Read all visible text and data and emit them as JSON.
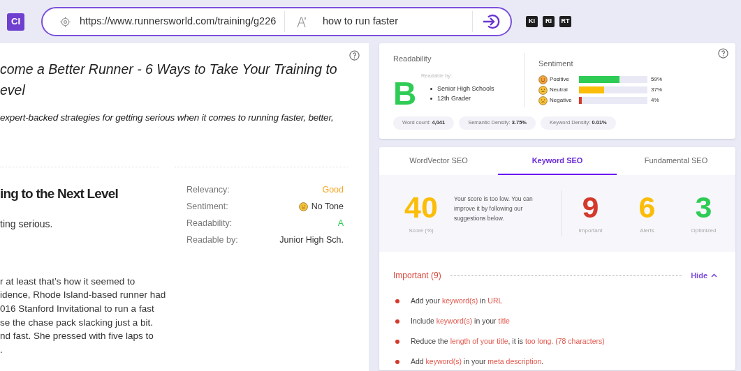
{
  "header": {
    "logo": "CI",
    "url_field": {
      "value": "https://www.runnersworld.com/training/g226"
    },
    "keyword_field": {
      "value": "how to run faster"
    },
    "tools": [
      "KI",
      "RI",
      "RT"
    ]
  },
  "article": {
    "title_lines": [
      "come a Better Runner - 6 Ways to Take Your Training to",
      "evel"
    ],
    "subtitle": "expert-backed strategies for getting serious when it comes to running faster, better,",
    "heading": "ing to the Next Level",
    "heading_sub": "ting serious.",
    "paragraph_lines": [
      "r at least that’s how it seemed to",
      "idence, Rhode Island-based runner had",
      "016 Stanford Invitational to run a fast",
      "se the chase pack slacking just a bit.",
      "nd fast. She pressed with five laps to",
      "."
    ],
    "meta": [
      {
        "label": "Relevancy:",
        "value": "Good",
        "kind": "rating",
        "color": "#f5a623"
      },
      {
        "label": "Sentiment:",
        "value": "No Tone",
        "kind": "emoji",
        "color": "#333333"
      },
      {
        "label": "Readability:",
        "value": "A",
        "kind": "rating",
        "color": "#2ecc55"
      },
      {
        "label": "Readable by:",
        "value": "Junior High Sch.",
        "kind": "text",
        "color": "#333333"
      }
    ]
  },
  "summary": {
    "readability": {
      "title": "Readability",
      "grade": "B",
      "readable_by_label": "Readable by:",
      "readable_by": [
        "Senior High Schools",
        "12th Grader"
      ]
    },
    "sentiment": {
      "title": "Sentiment",
      "rows": [
        {
          "label": "Positive",
          "level": 0.59,
          "reading": "59%",
          "color": "#2ecc55",
          "kind": "positive"
        },
        {
          "label": "Neutral",
          "level": 0.37,
          "reading": "37%",
          "color": "#fbbd08",
          "kind": "neutral"
        },
        {
          "label": "Negative",
          "level": 0.04,
          "reading": "4%",
          "color": "#d33a2c",
          "kind": "negative"
        }
      ]
    },
    "stats": [
      {
        "label": "Word count:",
        "value": "4,041"
      },
      {
        "label": "Semantic Density:",
        "value": "3.75%"
      },
      {
        "label": "Keyword Density:",
        "value": "0.01%"
      }
    ]
  },
  "seo": {
    "tabs": [
      {
        "label": "WordVector SEO",
        "selected": false
      },
      {
        "label": "Keyword SEO",
        "selected": true
      },
      {
        "label": "Fundamental SEO",
        "selected": false
      }
    ],
    "score": {
      "value": "40",
      "label": "Score (%)",
      "message": "Your score is too low. You can improve it by following our suggestions below."
    },
    "counts": [
      {
        "value": "9",
        "label": "Important",
        "color": "#d33a2c"
      },
      {
        "value": "6",
        "label": "Alerts",
        "color": "#fbbd08"
      },
      {
        "value": "3",
        "label": "Optimized",
        "color": "#2ecc55"
      }
    ],
    "section": {
      "title": "Important (9)",
      "toggle": "Hide",
      "expanded": true,
      "items": [
        [
          {
            "text": "Add your ",
            "hl": false
          },
          {
            "text": "keyword(s)",
            "hl": true
          },
          {
            "text": " in ",
            "hl": false
          },
          {
            "text": "URL",
            "hl": true
          }
        ],
        [
          {
            "text": "Include ",
            "hl": false
          },
          {
            "text": "keyword(s)",
            "hl": true
          },
          {
            "text": " in your ",
            "hl": false
          },
          {
            "text": "title",
            "hl": true
          }
        ],
        [
          {
            "text": "Reduce the ",
            "hl": false
          },
          {
            "text": "length of your title",
            "hl": true
          },
          {
            "text": ", it is ",
            "hl": false
          },
          {
            "text": "too long. (78 characters)",
            "hl": true
          }
        ],
        [
          {
            "text": "Add ",
            "hl": false
          },
          {
            "text": "keyword(s)",
            "hl": true
          },
          {
            "text": " in your ",
            "hl": false
          },
          {
            "text": "meta description",
            "hl": true
          },
          {
            "text": ".",
            "hl": false
          }
        ]
      ]
    }
  }
}
